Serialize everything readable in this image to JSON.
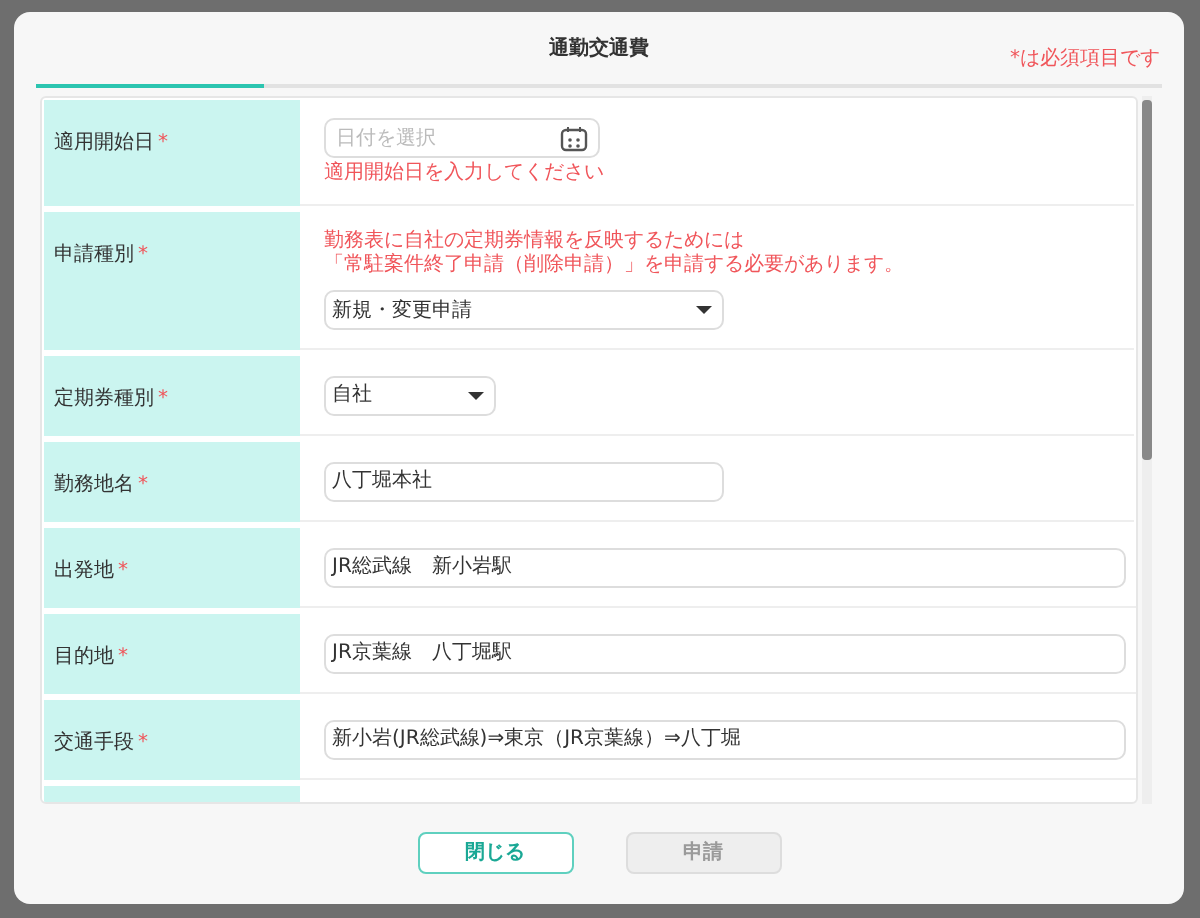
{
  "dialog": {
    "title": "通勤交通費",
    "required_note": "*は必須項目です"
  },
  "rows": [
    {
      "kind": "date",
      "label": "適用開始日",
      "mark": "*",
      "placeholder": "日付を選択",
      "error": "適用開始日を入力してください"
    },
    {
      "kind": "select",
      "label": "申請種別",
      "mark": "*",
      "notice": [
        "勤務表に自社の定期券情報を反映するためには",
        "「常駐案件終了申請（削除申請）」を申請する必要があります。"
      ],
      "value": "新規・変更申請"
    },
    {
      "kind": "select",
      "label": "定期券種別",
      "mark": "*",
      "value": "自社"
    },
    {
      "kind": "text",
      "label": "勤務地名",
      "mark": "*",
      "value": "八丁堀本社"
    },
    {
      "kind": "text",
      "label": "出発地",
      "mark": "*",
      "value": "JR総武線　新小岩駅"
    },
    {
      "kind": "text",
      "label": "目的地",
      "mark": "*",
      "value": "JR京葉線　八丁堀駅"
    },
    {
      "kind": "text",
      "label": "交通手段",
      "mark": "*",
      "value": "新小岩(JR総武線)⇒東京（JR京葉線）⇒八丁堀"
    },
    {
      "kind": "cut_off"
    }
  ],
  "buttons": [
    {
      "label": "閉じる",
      "disabled": false
    },
    {
      "label": "申請",
      "disabled": true
    }
  ]
}
